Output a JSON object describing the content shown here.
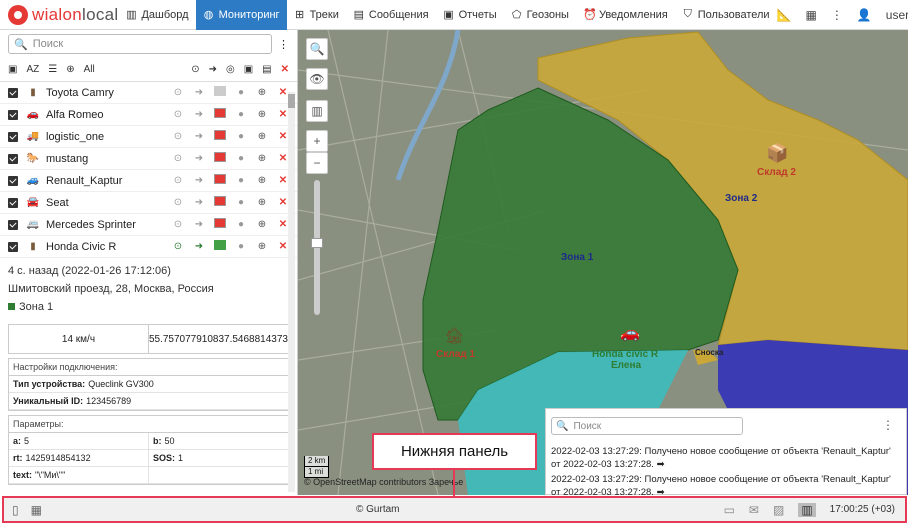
{
  "header": {
    "logo_primary": "wialon",
    "logo_secondary": "local",
    "nav": [
      {
        "label": "Дашборд",
        "icon": "dashboard-icon",
        "glyph": "▥"
      },
      {
        "label": "Мониторинг",
        "icon": "globe-icon",
        "glyph": "◍",
        "active": true
      },
      {
        "label": "Треки",
        "icon": "tracks-icon",
        "glyph": "⊞"
      },
      {
        "label": "Сообщения",
        "icon": "messages-icon",
        "glyph": "▤"
      },
      {
        "label": "Отчеты",
        "icon": "reports-icon",
        "glyph": "▣"
      },
      {
        "label": "Геозоны",
        "icon": "geofence-icon",
        "glyph": "⬠"
      },
      {
        "label": "Уведомления",
        "icon": "alarm-icon",
        "glyph": "⏰"
      },
      {
        "label": "Пользователи",
        "icon": "users-icon",
        "glyph": "⛉"
      }
    ],
    "user": "user",
    "accent_color": "#2d7bc4"
  },
  "sidebar": {
    "search_placeholder": "Поиск",
    "toolbar": {
      "sort_label": "AZ",
      "all_label": "All"
    },
    "units": [
      {
        "name": "Toyota Camry",
        "icon": "phone-icon",
        "glyph": "▮",
        "bar": "n",
        "active": false
      },
      {
        "name": "Alfa Romeo",
        "icon": "car-icon",
        "glyph": "🚗",
        "bar": "r",
        "active": false
      },
      {
        "name": "logistic_one",
        "icon": "truck-icon",
        "glyph": "🚚",
        "bar": "r",
        "active": false
      },
      {
        "name": "mustang",
        "icon": "horse-icon",
        "glyph": "🐎",
        "bar": "r",
        "active": false
      },
      {
        "name": "Renault_Kaptur",
        "icon": "car-icon",
        "glyph": "🚙",
        "bar": "r",
        "active": false
      },
      {
        "name": "Seat",
        "icon": "car-icon",
        "glyph": "🚘",
        "bar": "r",
        "active": false
      },
      {
        "name": "Mercedes Sprinter",
        "icon": "van-icon",
        "glyph": "🚐",
        "bar": "r",
        "active": false
      },
      {
        "name": "Honda Civic R",
        "icon": "phone-icon",
        "glyph": "▮",
        "bar": "g",
        "active": true
      }
    ],
    "details": {
      "last_message": "4 с. назад (2022-01-26 17:12:06)",
      "address": "Шмитовский проезд, 28, Москва, Россия",
      "zone": "Зона 1",
      "speed": "14 км/ч",
      "lat": "55.7570779108",
      "lon": "37.5468814373",
      "connection_title": "Настройки подключения:",
      "device_type_label": "Тип устройства:",
      "device_type": "Queclink GV300",
      "uid_label": "Уникальный ID:",
      "uid": "123456789",
      "params_title": "Параметры:",
      "params": [
        {
          "key": "a:",
          "value": "5",
          "key2": "b:",
          "value2": "50"
        },
        {
          "key": "rt:",
          "value": "1425914854132",
          "key2": "SOS:",
          "value2": "1"
        },
        {
          "key": "text:",
          "value": "\"\\\"Ми\\\"\"",
          "key2": "",
          "value2": ""
        }
      ]
    }
  },
  "map": {
    "labels": {
      "zone1": "Зона 1",
      "zone2": "Зона 2",
      "warehouse1": "Склад 1",
      "warehouse2": "Склад 2",
      "unit": "Honda civic R",
      "driver": "Елена",
      "street": "Заречье"
    },
    "scale_km": "2 km",
    "scale_mi": "1 mi",
    "attribution": "© OpenStreetMap contributors",
    "zone_colors": {
      "zone1": "#3b8a3b",
      "zone2": "#d6b43a",
      "cyan": "#3bc8c8",
      "blue": "#3b3bc8"
    }
  },
  "messages_panel": {
    "search_placeholder": "Поиск",
    "items": [
      {
        "text": "2022-02-03 13:27:29: Получено новое сообщение от объекта 'Renault_Kaptur'",
        "sub": "от 2022-02-03 13:27:28."
      },
      {
        "text": "2022-02-03 13:27:29: Получено новое сообщение от объекта 'Renault_Kaptur'",
        "sub": "от 2022-02-03 13:27:28."
      }
    ]
  },
  "callout": {
    "label": "Нижняя панель",
    "color": "#e53956"
  },
  "bottom": {
    "copyright": "© Gurtam",
    "time": "17:00:25 (+03)"
  }
}
